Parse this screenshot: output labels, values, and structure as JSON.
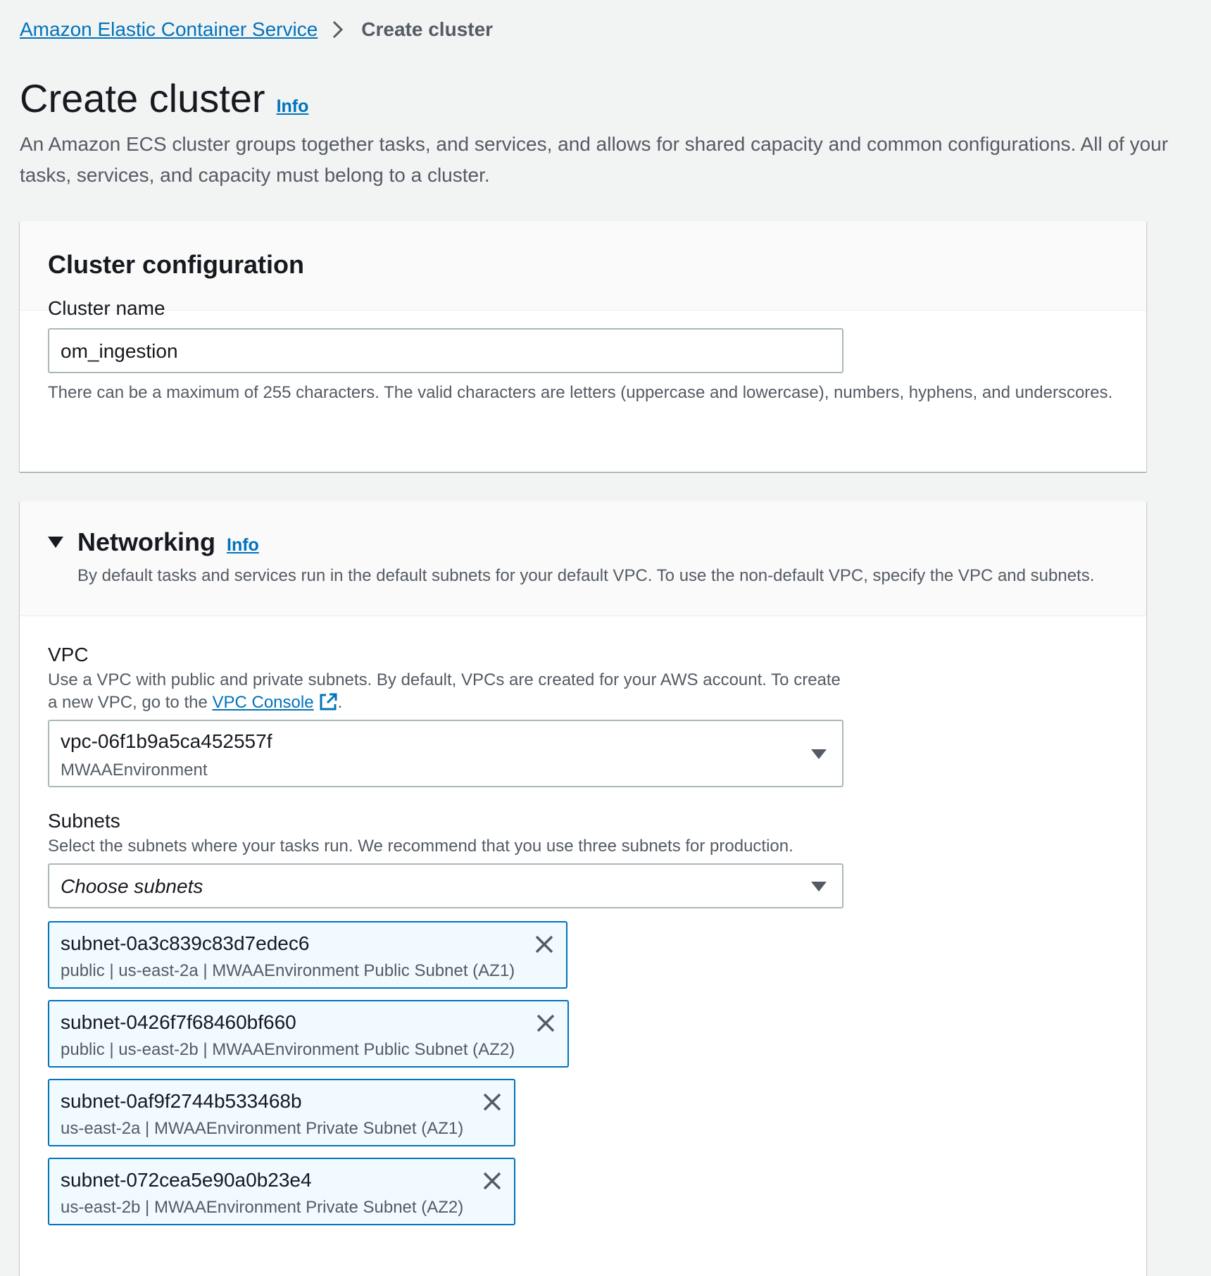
{
  "breadcrumb": {
    "service_link": "Amazon Elastic Container Service",
    "current": "Create cluster"
  },
  "page": {
    "title": "Create cluster",
    "info": "Info",
    "description": "An Amazon ECS cluster groups together tasks, and services, and allows for shared capacity and common configurations. All of your tasks, services, and capacity must belong to a cluster."
  },
  "cluster_config": {
    "heading": "Cluster configuration",
    "name_label": "Cluster name",
    "name_value": "om_ingestion",
    "name_hint": "There can be a maximum of 255 characters. The valid characters are letters (uppercase and lowercase), numbers, hyphens, and underscores."
  },
  "networking": {
    "heading": "Networking",
    "info": "Info",
    "description": "By default tasks and services run in the default subnets for your default VPC. To use the non-default VPC, specify the VPC and subnets.",
    "vpc": {
      "label": "VPC",
      "desc_line1": "Use a VPC with public and private subnets. By default, VPCs are created for your AWS account. To create",
      "desc_line2_prefix": "a new VPC, go to the ",
      "console_link": "VPC Console",
      "desc_line2_suffix": ".",
      "selected_id": "vpc-06f1b9a5ca452557f",
      "selected_name": "MWAAEnvironment"
    },
    "subnets": {
      "label": "Subnets",
      "description": "Select the subnets where your tasks run. We recommend that you use three subnets for production.",
      "placeholder": "Choose subnets",
      "selected": [
        {
          "id": "subnet-0a3c839c83d7edec6",
          "detail": "public | us-east-2a | MWAAEnvironment Public Subnet (AZ1)"
        },
        {
          "id": "subnet-0426f7f68460bf660",
          "detail": "public | us-east-2b | MWAAEnvironment Public Subnet (AZ2)"
        },
        {
          "id": "subnet-0af9f2744b533468b",
          "detail": "us-east-2a | MWAAEnvironment Private Subnet (AZ1)"
        },
        {
          "id": "subnet-072cea5e90a0b23e4",
          "detail": "us-east-2b | MWAAEnvironment Private Subnet (AZ2)"
        }
      ]
    }
  },
  "colors": {
    "link": "#0073bb",
    "token_bg": "#f1faff",
    "page_bg": "#f2f3f3"
  }
}
